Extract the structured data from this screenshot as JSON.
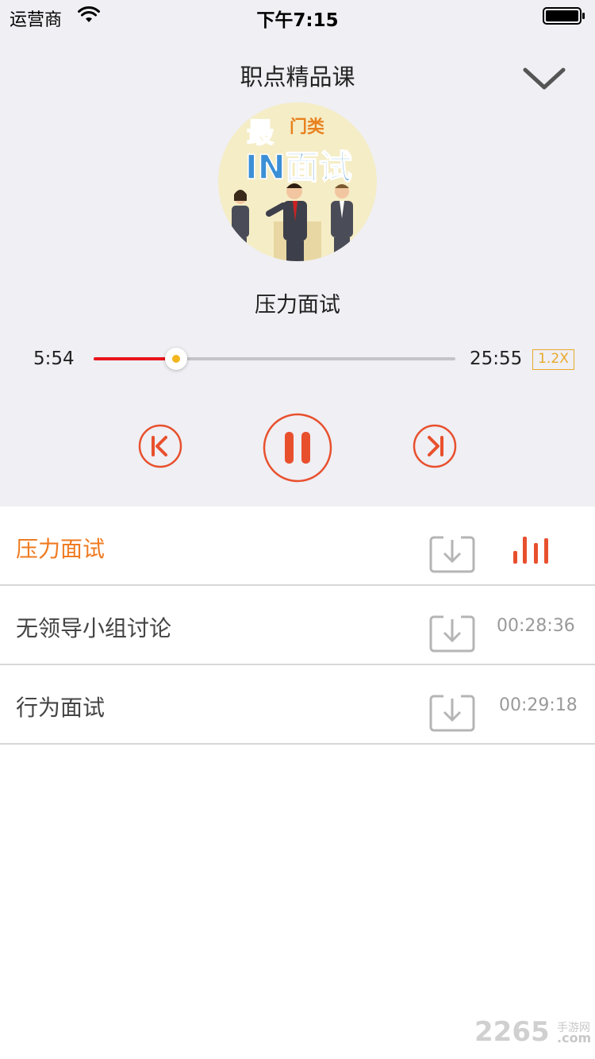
{
  "status_bar": {
    "carrier": "运营商",
    "time": "下午7:15"
  },
  "header": {
    "title": "职点精品课"
  },
  "cover": {
    "line1": "最",
    "line1b": "门类",
    "line2": "IN面试"
  },
  "now_playing": {
    "title": "压力面试",
    "elapsed": "5:54",
    "duration": "25:55",
    "progress_fraction": 0.228,
    "speed": "1.2X"
  },
  "colors": {
    "accent": "#ef7b22",
    "control_red": "#e8502d",
    "progress_red": "#e8141b",
    "speed_gold": "#e9a92a"
  },
  "playlist": [
    {
      "title": "压力面试",
      "duration": "",
      "state": "playing"
    },
    {
      "title": "无领导小组讨论",
      "duration": "00:28:36",
      "state": "idle"
    },
    {
      "title": "行为面试",
      "duration": "00:29:18",
      "state": "idle"
    }
  ],
  "watermark": {
    "number": "2265",
    "cn": "手游网",
    "domain": ".com"
  }
}
